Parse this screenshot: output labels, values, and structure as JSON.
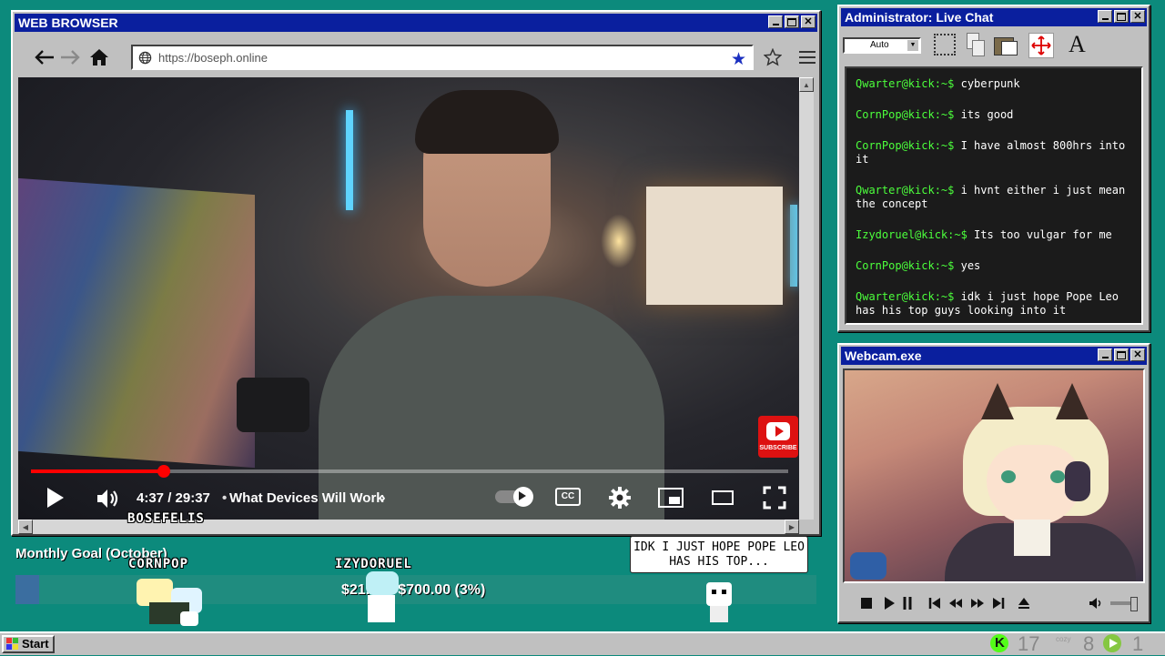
{
  "browser": {
    "title": "WEB BROWSER",
    "url": "https://boseph.online"
  },
  "video": {
    "time": "4:37 / 29:37",
    "chapter": "What Devices Will Work",
    "progress": 0.175,
    "subscribe_label": "SUBSCRIBE",
    "cc_label": "CC"
  },
  "overlay": {
    "host_name": "BOSEFELIS",
    "goal_title": "Monthly Goal (October)",
    "goal_amount": "$21.00 / $700.00 (3%)",
    "goal_progress": 0.03,
    "players": [
      "CORNPOP",
      "IZYDORUEL"
    ],
    "speech": "IDK I JUST HOPE POPE LEO HAS HIS TOP..."
  },
  "chat": {
    "title": "Administrator: Live Chat",
    "font_select": "Auto",
    "messages": [
      {
        "user": "Qwarter@kick:~$",
        "text": "cyberpunk"
      },
      {
        "user": "CornPop@kick:~$",
        "text": "its good"
      },
      {
        "user": "CornPop@kick:~$",
        "text": "I have almost 800hrs into it"
      },
      {
        "user": "Qwarter@kick:~$",
        "text": "i hvnt either i just mean the concept"
      },
      {
        "user": "Izydoruel@kick:~$",
        "text": "Its too vulgar for me"
      },
      {
        "user": "CornPop@kick:~$",
        "text": "yes"
      },
      {
        "user": "Qwarter@kick:~$",
        "text": "idk i just hope Pope Leo has his top guys looking into it"
      }
    ]
  },
  "webcam": {
    "title": "Webcam.exe"
  },
  "taskbar": {
    "start_label": "Start",
    "kick_count": "17",
    "tray_small": "cozy",
    "middle_count": "8",
    "rumble_count": "1"
  },
  "colors": {
    "desktop": "#0c8a7c",
    "titlebar": "#0a1f9e",
    "chat_user": "#4cff3c",
    "progress_red": "#ff0000",
    "kick_green": "#53fc18"
  }
}
